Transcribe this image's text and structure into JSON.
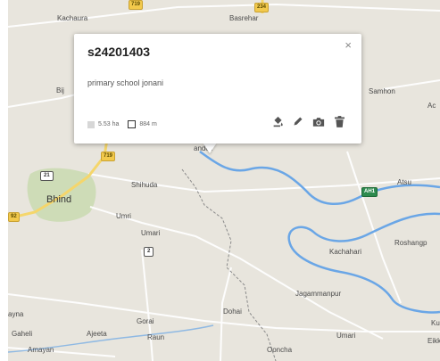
{
  "shields": {
    "top_yellow": "719",
    "top_yellow_2": "234",
    "s21": "21",
    "s719": "719",
    "s2": "2",
    "ah1": "AH1",
    "s92": "92"
  },
  "places": {
    "kachaura": "Kachaura",
    "basrehar": "Basrehar",
    "bi": "Bij",
    "samhon": "Samhon",
    "ac": "Ac",
    "bhind": "Bhind",
    "shihuda": "Shihuda",
    "umri": "Umri",
    "umari": "Umari",
    "atsu": "Atsu",
    "roshangpur": "Roshangp",
    "kachahari": "Kachahari",
    "jagammanpur": "Jagammanpur",
    "ayna": "ayna",
    "dohai": "Dohai",
    "gorai": "Gorai",
    "raun": "Raun",
    "gaheli": "Gaheli",
    "ajeeta": "Ajeeta",
    "amayan": "Amayan",
    "umari2": "Umari",
    "ku": "Ku",
    "eikk": "Eikko",
    "ooncha": "Ooncha",
    "andoli": "andoli"
  },
  "popup": {
    "title": "s24201403",
    "description": "primary school jonani",
    "area": "5.53 ha",
    "perimeter": "884 m",
    "close_glyph": "×"
  },
  "colors": {
    "map_bg": "#e8e5dd",
    "river": "#6aa6e6",
    "road": "#ffffff",
    "highway": "#f5d66b",
    "forest": "#c9dbb0"
  },
  "icons": {
    "style": "paint-bucket-icon",
    "edit": "pencil-icon",
    "photo": "camera-icon",
    "delete": "trash-icon"
  }
}
